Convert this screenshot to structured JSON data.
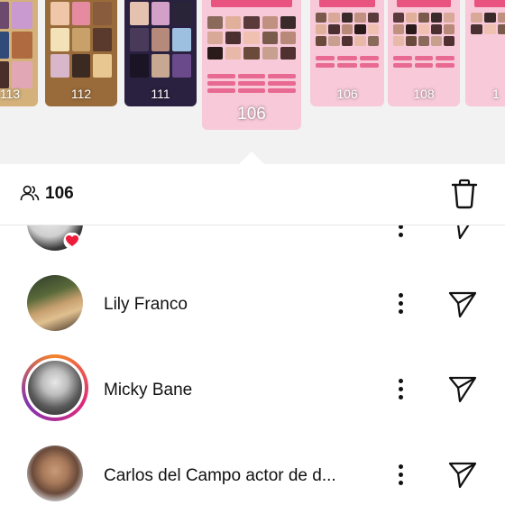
{
  "stories": [
    {
      "count": "113"
    },
    {
      "count": "112"
    },
    {
      "count": "111"
    },
    {
      "count": "106",
      "selected": true
    },
    {
      "count": "106"
    },
    {
      "count": "108"
    },
    {
      "count": "1"
    }
  ],
  "header": {
    "viewer_count": "106"
  },
  "viewers": [
    {
      "name": "Lily Franco"
    },
    {
      "name": "Micky Bane"
    },
    {
      "name": "Carlos del Campo actor de d..."
    }
  ],
  "colors": {
    "ring_start": "#f58529",
    "ring_mid": "#dd2a7b",
    "ring_end": "#8134af",
    "heart": "#ed1c3a",
    "story_pink": "#f7c9d9"
  }
}
